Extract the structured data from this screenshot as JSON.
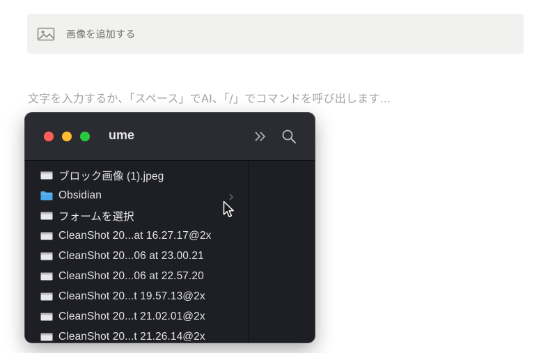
{
  "add_image": {
    "label": "画像を追加する",
    "icon": "image-icon"
  },
  "editor": {
    "placeholder": "文字を入力するか、「スペース」でAI、「/」でコマンドを呼び出します..."
  },
  "finder": {
    "title": "ume",
    "toolbar": {
      "more_icon": "double-chevron-right-icon",
      "search_icon": "search-icon"
    },
    "items": [
      {
        "name": "ブロック画像 (1).jpeg",
        "kind": "image"
      },
      {
        "name": "Obsidian",
        "kind": "folder"
      },
      {
        "name": "フォームを選択",
        "kind": "image"
      },
      {
        "name": "CleanShot 20...at 16.27.17@2x",
        "kind": "image"
      },
      {
        "name": "CleanShot 20...06 at 23.00.21",
        "kind": "image"
      },
      {
        "name": "CleanShot 20...06 at 22.57.20",
        "kind": "image"
      },
      {
        "name": "CleanShot 20...t 19.57.13@2x",
        "kind": "image"
      },
      {
        "name": "CleanShot 20...t 21.02.01@2x",
        "kind": "image"
      },
      {
        "name": "CleanShot 20...t 21.26.14@2x",
        "kind": "image"
      }
    ]
  },
  "colors": {
    "folder": "#4aa8e8",
    "traffic_red": "#ff5f57",
    "traffic_yellow": "#febc2e",
    "traffic_green": "#28c840"
  }
}
